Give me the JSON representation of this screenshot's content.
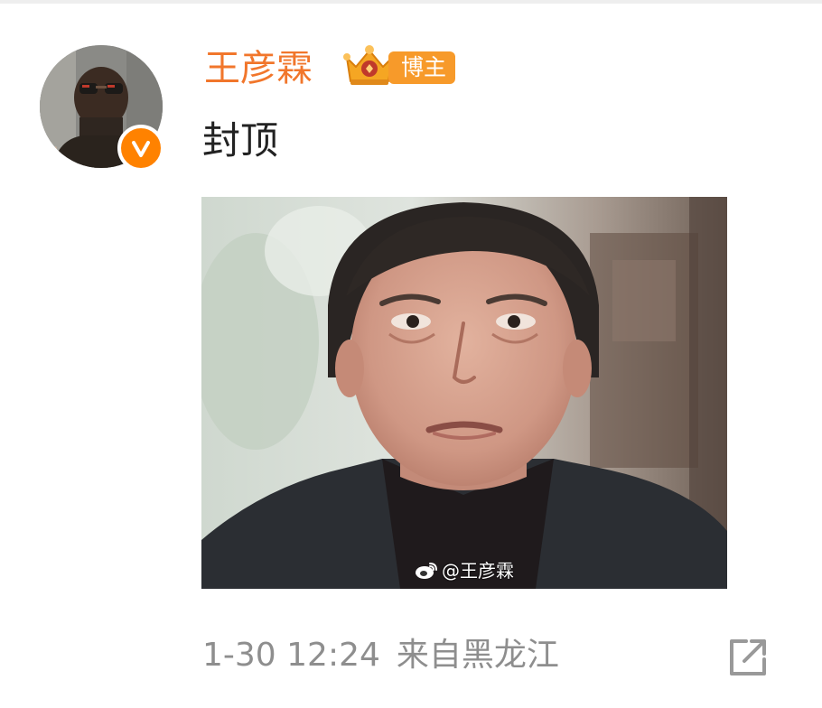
{
  "post": {
    "author": {
      "name": "王彦霖",
      "badge_label": "博主",
      "verified": true,
      "icons": {
        "avatar": "avatar-image",
        "verified": "verified-v-badge-icon",
        "level": "crown-level-icon"
      }
    },
    "text": "封顶",
    "image": {
      "watermark_text": "@王彦霖",
      "watermark_icon": "weibo-logo-icon"
    },
    "meta": {
      "timestamp": "1-30 12:24",
      "source": "来自黑龙江"
    },
    "actions": {
      "share_icon": "share-external-icon"
    }
  },
  "colors": {
    "username": "#f1762b",
    "verified_badge": "#ff8200",
    "blogger_badge": "#f79a2a",
    "post_text": "#222222",
    "meta_text": "#8e8e8e",
    "share_icon": "#999999"
  }
}
